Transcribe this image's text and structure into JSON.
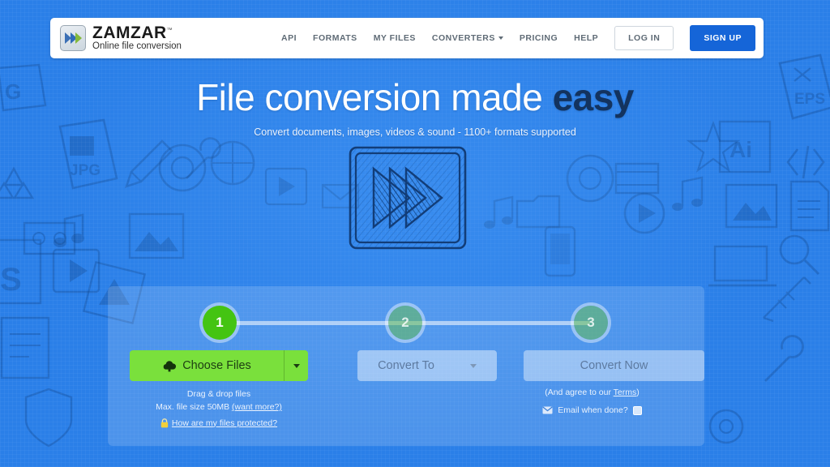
{
  "brand": {
    "name": "ZAMZAR",
    "tm": "™",
    "tagline": "Online file conversion",
    "logo_icon": "double-chevron-icon",
    "colors": {
      "blue": "#2a7fe8",
      "dark_blue": "#1565d8",
      "green": "#7ae03c",
      "step_green": "#44c412"
    }
  },
  "nav": {
    "items": [
      {
        "label": "API",
        "has_caret": false
      },
      {
        "label": "FORMATS",
        "has_caret": false
      },
      {
        "label": "MY FILES",
        "has_caret": false
      },
      {
        "label": "CONVERTERS",
        "has_caret": true
      },
      {
        "label": "PRICING",
        "has_caret": false
      },
      {
        "label": "HELP",
        "has_caret": false
      }
    ],
    "login_label": "LOG IN",
    "signup_label": "SIGN UP"
  },
  "hero": {
    "title_normal": "File conversion made ",
    "title_bold": "easy",
    "subtitle": "Convert documents, images, videos & sound - 1100+ formats supported",
    "illustration": "sketch-play-convert-icon"
  },
  "stepper": {
    "steps": [
      {
        "number": "1",
        "state": "active"
      },
      {
        "number": "2",
        "state": "idle"
      },
      {
        "number": "3",
        "state": "idle"
      }
    ]
  },
  "actions": {
    "choose_files_label": "Choose Files",
    "choose_files_icon": "upload-cloud-icon",
    "convert_to_label": "Convert To",
    "convert_now_label": "Convert Now"
  },
  "microcopy": {
    "drag_drop": "Drag & drop files",
    "max_size_text": "Max. file size 50MB ",
    "want_more_link": "(want more?)",
    "protected_link": "How are my files protected?",
    "lock_icon": "lock-icon",
    "agree_prefix": "(And agree to our ",
    "terms_link": "Terms",
    "agree_suffix": ")",
    "email_icon": "envelope-icon",
    "email_label": "Email when done?",
    "email_checked": false
  },
  "background": {
    "doodle_labels": [
      "G",
      "JPG",
      "S",
      "EPS",
      "Ai",
      "</>"
    ]
  }
}
